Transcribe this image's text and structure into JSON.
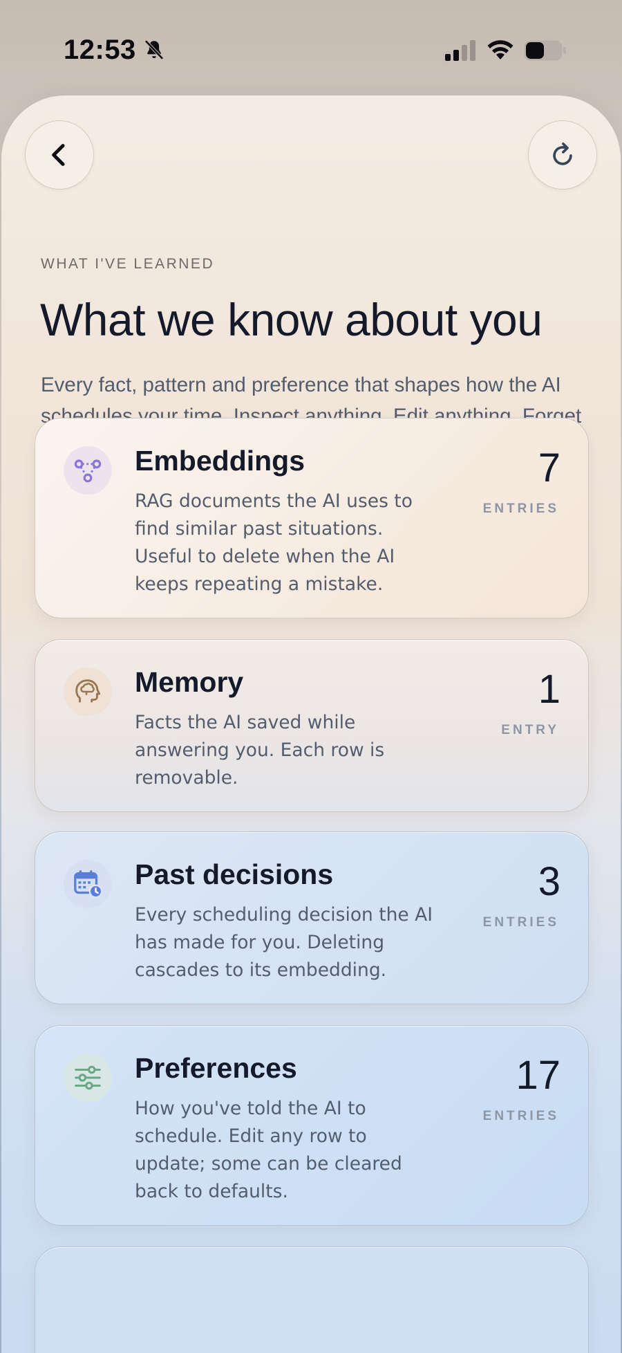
{
  "status_bar": {
    "time": "12:53",
    "icons": [
      "bell-slash-icon",
      "cellular-signal-icon",
      "wifi-icon",
      "battery-icon"
    ]
  },
  "header": {
    "back_icon": "chevron-left-icon",
    "refresh_icon": "refresh-icon"
  },
  "page": {
    "eyebrow": "WHAT I'VE LEARNED",
    "title": "What we know about you",
    "subtitle": "Every fact, pattern and preference that shapes how the AI schedules your time. Inspect anything. Edit anything. Forget anything."
  },
  "cards": [
    {
      "icon": "graph-nodes-icon",
      "title": "Embeddings",
      "description": "RAG documents the AI uses to find similar past situations. Useful to delete when the AI keeps repeating a mistake.",
      "count": "7",
      "unit": "ENTRIES"
    },
    {
      "icon": "brain-head-icon",
      "title": "Memory",
      "description": "Facts the AI saved while answering you. Each row is removable.",
      "count": "1",
      "unit": "ENTRY"
    },
    {
      "icon": "calendar-clock-icon",
      "title": "Past decisions",
      "description": "Every scheduling decision the AI has made for you. Deleting cascades to its embedding.",
      "count": "3",
      "unit": "ENTRIES"
    },
    {
      "icon": "sliders-icon",
      "title": "Preferences",
      "description": "How you've told the AI to schedule. Edit any row to update; some can be cleared back to defaults.",
      "count": "17",
      "unit": "ENTRIES"
    }
  ],
  "colors": {
    "title_text": "#151a2a",
    "body_text": "#545d6d",
    "unit_text": "#8e95a3",
    "embeddings_accent": "#8a78d6",
    "memory_accent": "#b08a5c",
    "decisions_accent": "#5b7fd8",
    "preferences_accent": "#6aa786"
  }
}
